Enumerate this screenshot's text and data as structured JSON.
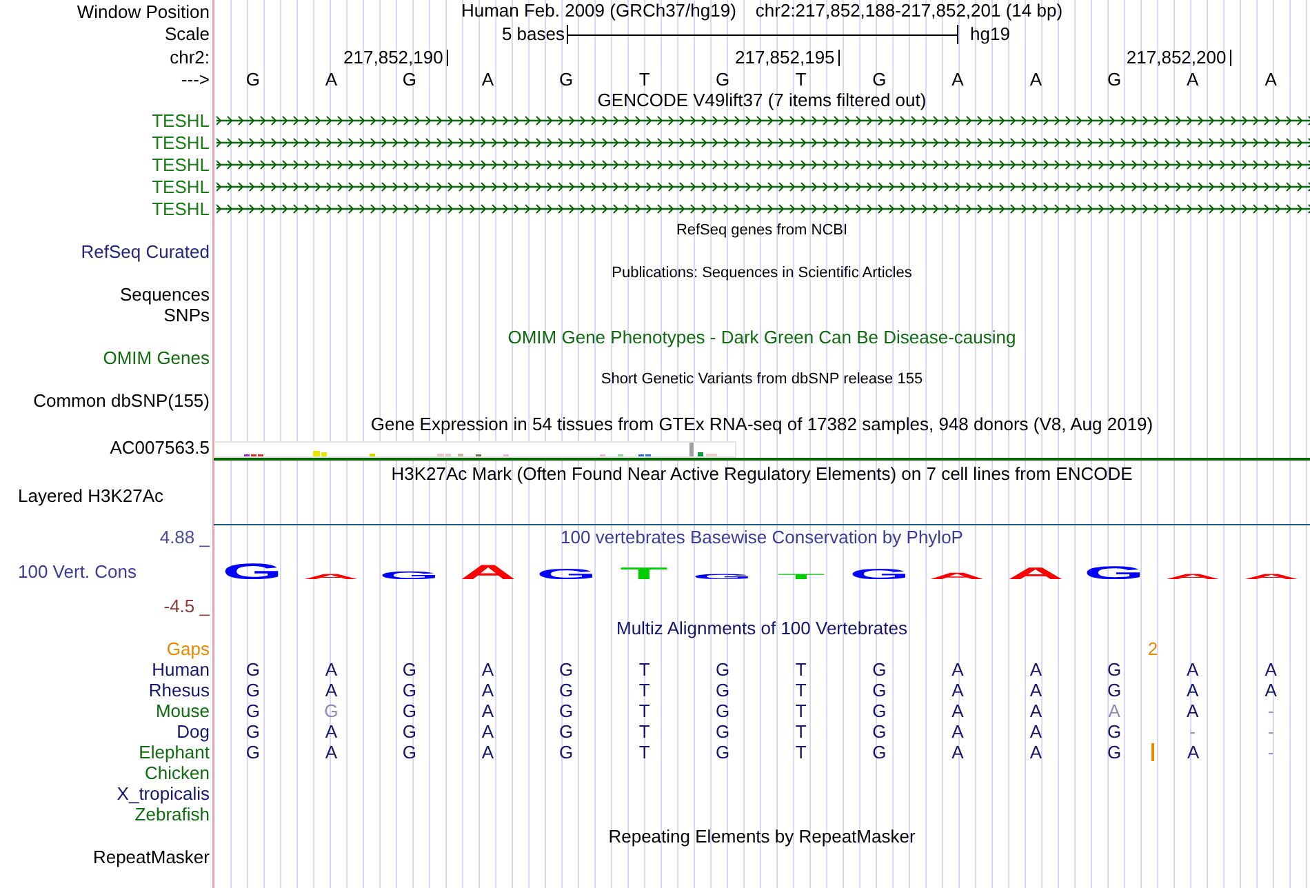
{
  "header": {
    "label": "Window Position",
    "title": "Human Feb. 2009 (GRCh37/hg19)",
    "position": "chr2:217,852,188-217,852,201 (14 bp)"
  },
  "scale": {
    "label": "Scale",
    "span": "5 bases",
    "assembly": "hg19"
  },
  "ruler": {
    "label": "chr2:",
    "ticks": [
      {
        "text": "217,852,190"
      },
      {
        "text": "217,852,195"
      },
      {
        "text": "217,852,200"
      }
    ]
  },
  "sequence": {
    "label": "--->",
    "bases": [
      "G",
      "A",
      "G",
      "A",
      "G",
      "T",
      "G",
      "T",
      "G",
      "A",
      "A",
      "G",
      "A",
      "A"
    ]
  },
  "tracks": [
    {
      "kind": "genes",
      "title": {
        "text": "GENCODE V49lift37 (7 items filtered out)",
        "color": "#000000"
      },
      "items": [
        {
          "label": "TESHL",
          "color": "#1a7d1a"
        },
        {
          "label": "TESHL",
          "color": "#1a7d1a"
        },
        {
          "label": "TESHL",
          "color": "#1a7d1a"
        },
        {
          "label": "TESHL",
          "color": "#1a7d1a"
        },
        {
          "label": "TESHL",
          "color": "#1a7d1a"
        }
      ]
    },
    {
      "kind": "compact",
      "title": {
        "text": "RefSeq genes from NCBI",
        "color": "#000000"
      },
      "label_lines": [
        "RefSeq Curated"
      ],
      "color": "#25257a"
    },
    {
      "kind": "compact",
      "title": {
        "text": "Publications: Sequences in Scientific Articles",
        "color": "#000000"
      },
      "label_lines": [
        "Sequences",
        "SNPs"
      ],
      "color": "#000000"
    },
    {
      "kind": "track",
      "title": {
        "text": "OMIM Gene Phenotypes - Dark Green Can Be Disease-causing",
        "color": "#0f6b0f"
      },
      "label_lines": [
        "OMIM Genes"
      ],
      "color": "#0f6b0f"
    },
    {
      "kind": "compact",
      "title": {
        "text": "Short Genetic Variants from dbSNP release 155",
        "color": "#000000"
      },
      "label_lines": [
        "Common dbSNP(155)"
      ],
      "color": "#000000"
    },
    {
      "kind": "expression",
      "title": {
        "text": "Gene Expression in 54 tissues from GTEx RNA-seq of 17382 samples, 948 donors (V8, Aug 2019)",
        "color": "#000000"
      },
      "label": "AC007563.5",
      "color": "#000000"
    },
    {
      "kind": "layered",
      "title": {
        "text": "H3K27Ac Mark (Often Found Near Active Regulatory Elements) on 7 cell lines from ENCODE",
        "color": "#000000"
      },
      "label": "Layered H3K27Ac",
      "color": "#000000"
    },
    {
      "kind": "conservation",
      "title": {
        "text": "100 vertebrates Basewise Conservation by PhyloP",
        "color": "#3c3c96"
      },
      "label": "100 Vert. Cons",
      "color": "#3c3c96",
      "max": "4.88 _",
      "min": "-4.5 _",
      "logo": [
        {
          "base": "G",
          "color": "#0000ff"
        },
        {
          "base": "A",
          "color": "#ff0000"
        },
        {
          "base": "G",
          "color": "#0000ff"
        },
        {
          "base": "A",
          "color": "#ff0000"
        },
        {
          "base": "G",
          "color": "#0000ff"
        },
        {
          "base": "T",
          "color": "#00cc00"
        },
        {
          "base": "G",
          "color": "#0000ff"
        },
        {
          "base": "T",
          "color": "#00cc00"
        },
        {
          "base": "G",
          "color": "#0000ff"
        },
        {
          "base": "A",
          "color": "#ff0000"
        },
        {
          "base": "A",
          "color": "#ff0000"
        },
        {
          "base": "G",
          "color": "#0000ff"
        },
        {
          "base": "A",
          "color": "#ff0000"
        },
        {
          "base": "A",
          "color": "#ff0000"
        }
      ]
    },
    {
      "kind": "alignment",
      "title": {
        "text": "Multiz Alignments of 100 Vertebrates",
        "color": "#14146b"
      },
      "gaps": {
        "label": "Gaps",
        "counts": [
          {
            "text": "2"
          }
        ]
      },
      "species": [
        {
          "name": "Human",
          "color": "#16166e",
          "bases": [
            {
              "base": "G",
              "differs": false,
              "insertion": false
            },
            {
              "base": "A",
              "differs": false,
              "insertion": false
            },
            {
              "base": "G",
              "differs": false,
              "insertion": false
            },
            {
              "base": "A",
              "differs": false,
              "insertion": false
            },
            {
              "base": "G",
              "differs": false,
              "insertion": false
            },
            {
              "base": "T",
              "differs": false,
              "insertion": false
            },
            {
              "base": "G",
              "differs": false,
              "insertion": false
            },
            {
              "base": "T",
              "differs": false,
              "insertion": false
            },
            {
              "base": "G",
              "differs": false,
              "insertion": false
            },
            {
              "base": "A",
              "differs": false,
              "insertion": false
            },
            {
              "base": "A",
              "differs": false,
              "insertion": false
            },
            {
              "base": "G",
              "differs": false,
              "insertion": false
            },
            {
              "base": "A",
              "differs": false,
              "insertion": false
            },
            {
              "base": "A",
              "differs": false,
              "insertion": false
            }
          ]
        },
        {
          "name": "Rhesus",
          "color": "#16166e",
          "bases": [
            {
              "base": "G",
              "differs": false,
              "insertion": false
            },
            {
              "base": "A",
              "differs": false,
              "insertion": false
            },
            {
              "base": "G",
              "differs": false,
              "insertion": false
            },
            {
              "base": "A",
              "differs": false,
              "insertion": false
            },
            {
              "base": "G",
              "differs": false,
              "insertion": false
            },
            {
              "base": "T",
              "differs": false,
              "insertion": false
            },
            {
              "base": "G",
              "differs": false,
              "insertion": false
            },
            {
              "base": "T",
              "differs": false,
              "insertion": false
            },
            {
              "base": "G",
              "differs": false,
              "insertion": false
            },
            {
              "base": "A",
              "differs": false,
              "insertion": false
            },
            {
              "base": "A",
              "differs": false,
              "insertion": false
            },
            {
              "base": "G",
              "differs": false,
              "insertion": false
            },
            {
              "base": "A",
              "differs": false,
              "insertion": false
            },
            {
              "base": "A",
              "differs": false,
              "insertion": false
            }
          ]
        },
        {
          "name": "Mouse",
          "color": "#0f6b0f",
          "bases": [
            {
              "base": "G",
              "differs": false,
              "insertion": false
            },
            {
              "base": "G",
              "differs": true,
              "insertion": false
            },
            {
              "base": "G",
              "differs": false,
              "insertion": false
            },
            {
              "base": "A",
              "differs": false,
              "insertion": false
            },
            {
              "base": "G",
              "differs": false,
              "insertion": false
            },
            {
              "base": "T",
              "differs": false,
              "insertion": false
            },
            {
              "base": "G",
              "differs": false,
              "insertion": false
            },
            {
              "base": "T",
              "differs": false,
              "insertion": false
            },
            {
              "base": "G",
              "differs": false,
              "insertion": false
            },
            {
              "base": "A",
              "differs": false,
              "insertion": false
            },
            {
              "base": "A",
              "differs": false,
              "insertion": false
            },
            {
              "base": "A",
              "differs": true,
              "insertion": false
            },
            {
              "base": "A",
              "differs": false,
              "insertion": false
            },
            {
              "base": "-",
              "differs": true,
              "insertion": false
            }
          ]
        },
        {
          "name": "Dog",
          "color": "#16166e",
          "bases": [
            {
              "base": "G",
              "differs": false,
              "insertion": false
            },
            {
              "base": "A",
              "differs": false,
              "insertion": false
            },
            {
              "base": "G",
              "differs": false,
              "insertion": false
            },
            {
              "base": "A",
              "differs": false,
              "insertion": false
            },
            {
              "base": "G",
              "differs": false,
              "insertion": false
            },
            {
              "base": "T",
              "differs": false,
              "insertion": false
            },
            {
              "base": "G",
              "differs": false,
              "insertion": false
            },
            {
              "base": "T",
              "differs": false,
              "insertion": false
            },
            {
              "base": "G",
              "differs": false,
              "insertion": false
            },
            {
              "base": "A",
              "differs": false,
              "insertion": false
            },
            {
              "base": "A",
              "differs": false,
              "insertion": false
            },
            {
              "base": "G",
              "differs": false,
              "insertion": false
            },
            {
              "base": "-",
              "differs": true,
              "insertion": false
            },
            {
              "base": "-",
              "differs": true,
              "insertion": false
            }
          ]
        },
        {
          "name": "Elephant",
          "color": "#0f6b0f",
          "bases": [
            {
              "base": "G",
              "differs": false,
              "insertion": false
            },
            {
              "base": "A",
              "differs": false,
              "insertion": false
            },
            {
              "base": "G",
              "differs": false,
              "insertion": false
            },
            {
              "base": "A",
              "differs": false,
              "insertion": false
            },
            {
              "base": "G",
              "differs": false,
              "insertion": false
            },
            {
              "base": "T",
              "differs": false,
              "insertion": false
            },
            {
              "base": "G",
              "differs": false,
              "insertion": false
            },
            {
              "base": "T",
              "differs": false,
              "insertion": false
            },
            {
              "base": "G",
              "differs": false,
              "insertion": false
            },
            {
              "base": "A",
              "differs": false,
              "insertion": false
            },
            {
              "base": "A",
              "differs": false,
              "insertion": false
            },
            {
              "base": "G",
              "differs": false,
              "insertion": false
            },
            {
              "base": "A",
              "differs": false,
              "insertion": true
            },
            {
              "base": "-",
              "differs": true,
              "insertion": false
            }
          ]
        },
        {
          "name": "Chicken",
          "color": "#0f6b0f"
        },
        {
          "name": "X_tropicalis",
          "color": "#16166e"
        },
        {
          "name": "Zebrafish",
          "color": "#0f6b0f"
        }
      ]
    },
    {
      "kind": "track",
      "title": {
        "text": "Repeating Elements by RepeatMasker",
        "color": "#000000"
      },
      "label_lines": [
        "RepeatMasker"
      ],
      "color": "#000000"
    }
  ]
}
